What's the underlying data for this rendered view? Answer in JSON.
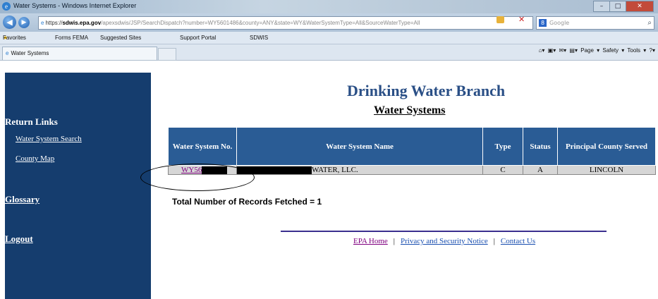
{
  "window": {
    "title": "Water Systems - Windows Internet Explorer"
  },
  "browser": {
    "address_prefix": "https://",
    "address_domain": "sdwis.epa.gov",
    "address_rest": "/apexsdwis/JSP/SearchDispatch?number=WY5601486&county=ANY&state=WY&WaterSystemType=All&SourceWaterType=All",
    "search_placeholder": "Google",
    "favorites_label": "Favorites",
    "fav_items": [
      "Forms FEMA",
      "Suggested Sites",
      "Support Portal",
      "SDWIS"
    ],
    "tab_label": "Water Systems",
    "command_bar": "Page ▾  Safety ▾  Tools ▾"
  },
  "sidebar": {
    "return_links": "Return Links",
    "water_system_search": "Water System Search",
    "county_map": "County Map",
    "glossary": "Glossary",
    "logout": "Logout"
  },
  "main": {
    "heading": "Drinking Water Branch",
    "subheading": "Water Systems",
    "table": {
      "headers": [
        "Water System No.",
        "Water System Name",
        "Type",
        "Status",
        "Principal County Served"
      ],
      "rows": [
        {
          "system_no": "WY56",
          "system_name": "WATER, LLC.",
          "type": "C",
          "status": "A",
          "county": "LINCOLN"
        }
      ]
    },
    "total_records": "Total Number of Records Fetched = 1"
  },
  "footer": {
    "epa_home": "EPA Home",
    "privacy": "Privacy and Security Notice",
    "contact": "Contact Us",
    "separator": "|"
  },
  "colors": {
    "sidebar": "#153d6e",
    "table_header": "#2a5c95",
    "heading": "#2a4f86"
  }
}
